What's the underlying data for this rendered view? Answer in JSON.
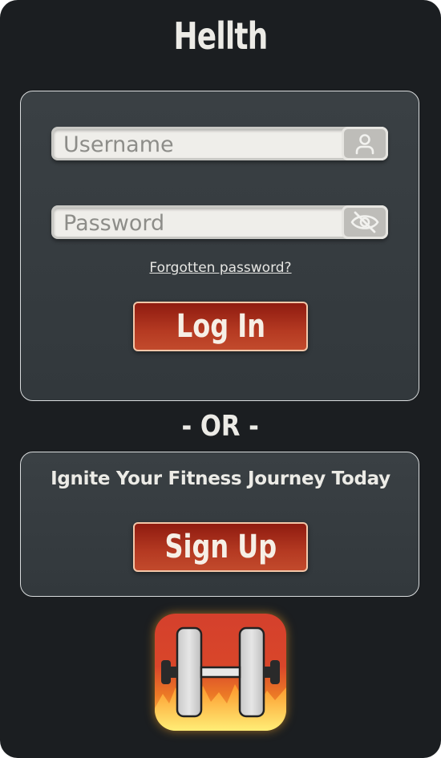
{
  "app": {
    "title": "Hellth"
  },
  "login": {
    "username_placeholder": "Username",
    "password_placeholder": "Password",
    "forgot_label": "Forgotten password?",
    "login_label": "Log In",
    "username_icon": "user-icon",
    "password_icon": "eye-off-icon"
  },
  "divider": {
    "label": "- OR -"
  },
  "signup": {
    "tagline": "Ignite Your Fitness Journey Today",
    "signup_label": "Sign Up"
  },
  "logo": {
    "icon": "dumbbell-flame-logo"
  },
  "colors": {
    "background": "#1b1e21",
    "card": "#363c40",
    "accent_red": "#b53a22",
    "field": "#efeeea"
  }
}
